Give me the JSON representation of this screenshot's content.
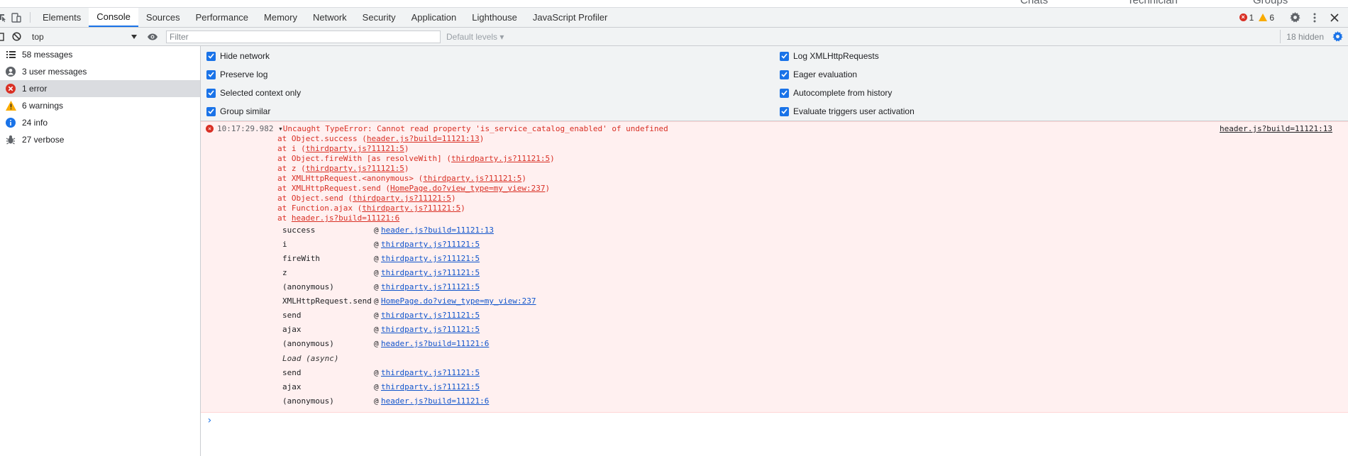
{
  "page_strip": {
    "items": [
      "Chats",
      "Technician",
      "Groups"
    ]
  },
  "tabs": [
    "Elements",
    "Console",
    "Sources",
    "Performance",
    "Memory",
    "Network",
    "Security",
    "Application",
    "Lighthouse",
    "JavaScript Profiler"
  ],
  "active_tab": "Console",
  "counts": {
    "errors": "1",
    "warnings": "6"
  },
  "toolbar": {
    "context": "top",
    "filter_placeholder": "Filter",
    "levels": "Default levels",
    "hidden": "18 hidden"
  },
  "sidebar": {
    "items": [
      {
        "label": "58 messages",
        "icon": "list-icon"
      },
      {
        "label": "3 user messages",
        "icon": "user-icon"
      },
      {
        "label": "1 error",
        "icon": "error-icon"
      },
      {
        "label": "6 warnings",
        "icon": "warning-icon"
      },
      {
        "label": "24 info",
        "icon": "info-icon"
      },
      {
        "label": "27 verbose",
        "icon": "bug-icon"
      }
    ],
    "selected": "1 error"
  },
  "settings": {
    "left": [
      "Hide network",
      "Preserve log",
      "Selected context only",
      "Group similar"
    ],
    "right": [
      "Log XMLHttpRequests",
      "Eager evaluation",
      "Autocomplete from history",
      "Evaluate triggers user activation"
    ]
  },
  "error": {
    "timestamp": "10:17:29.982",
    "message": "Uncaught TypeError: Cannot read property 'is_service_catalog_enabled' of undefined",
    "source": "header.js?build=11121:13",
    "stack": [
      {
        "pre": "at Object.success (",
        "link": "header.js?build=11121:13",
        "post": ")"
      },
      {
        "pre": "at i (",
        "link": "thirdparty.js?11121:5",
        "post": ")"
      },
      {
        "pre": "at Object.fireWith [as resolveWith] (",
        "link": "thirdparty.js?11121:5",
        "post": ")"
      },
      {
        "pre": "at z (",
        "link": "thirdparty.js?11121:5",
        "post": ")"
      },
      {
        "pre": "at XMLHttpRequest.<anonymous> (",
        "link": "thirdparty.js?11121:5",
        "post": ")"
      },
      {
        "pre": "at XMLHttpRequest.send (",
        "link": "HomePage.do?view_type=my_view:237",
        "post": ")"
      },
      {
        "pre": "at Object.send (",
        "link": "thirdparty.js?11121:5",
        "post": ")"
      },
      {
        "pre": "at Function.ajax (",
        "link": "thirdparty.js?11121:5",
        "post": ")"
      },
      {
        "pre": "at ",
        "link": "header.js?build=11121:6",
        "post": ""
      }
    ],
    "frames": [
      {
        "fn": "success",
        "link": "header.js?build=11121:13"
      },
      {
        "fn": "i",
        "link": "thirdparty.js?11121:5"
      },
      {
        "fn": "fireWith",
        "link": "thirdparty.js?11121:5"
      },
      {
        "fn": "z",
        "link": "thirdparty.js?11121:5"
      },
      {
        "fn": "(anonymous)",
        "link": "thirdparty.js?11121:5"
      },
      {
        "fn": "XMLHttpRequest.send",
        "link": "HomePage.do?view_type=my_view:237"
      },
      {
        "fn": "send",
        "link": "thirdparty.js?11121:5"
      },
      {
        "fn": "ajax",
        "link": "thirdparty.js?11121:5"
      },
      {
        "fn": "(anonymous)",
        "link": "header.js?build=11121:6"
      }
    ],
    "async_label": "Load (async)",
    "async_frames": [
      {
        "fn": "send",
        "link": "thirdparty.js?11121:5"
      },
      {
        "fn": "ajax",
        "link": "thirdparty.js?11121:5"
      },
      {
        "fn": "(anonymous)",
        "link": "header.js?build=11121:6"
      }
    ]
  },
  "colors": {
    "accent": "#1a73e8",
    "error": "#d93025",
    "warning": "#f9ab00",
    "error_bg": "#fff0f0"
  }
}
